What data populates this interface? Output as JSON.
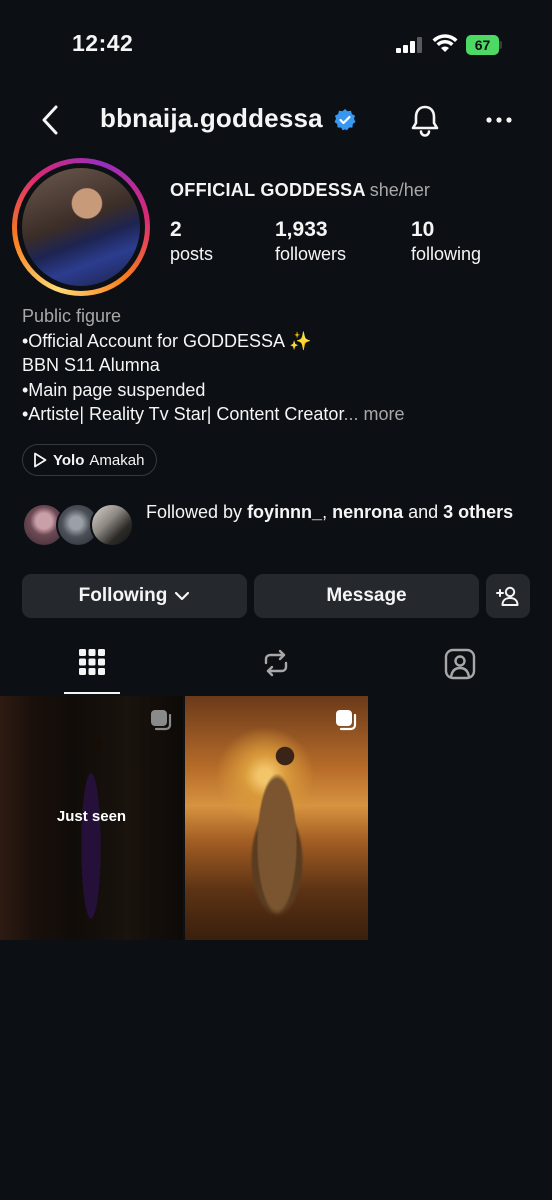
{
  "status_bar": {
    "time": "12:42",
    "battery": "67"
  },
  "header": {
    "username": "bbnaija.goddessa"
  },
  "profile": {
    "full_name": "OFFICIAL GODDESSA",
    "pronouns": "she/her",
    "stats": [
      {
        "value": "2",
        "label": "posts"
      },
      {
        "value": "1,933",
        "label": "followers"
      },
      {
        "value": "10",
        "label": "following"
      }
    ],
    "bio": {
      "category": "Public figure",
      "lines": [
        "•Official Account for GODDESSA ✨",
        "BBN S11 Alumna",
        "•Main page suspended",
        "•Artiste| Reality Tv Star| Content Creator"
      ],
      "ellipsis": "...",
      "more": "more"
    },
    "music": {
      "song": "Yolo",
      "artist": "Amakah"
    },
    "mutuals": {
      "prefix": "Followed by ",
      "user1": "foyinnn_",
      "sep": ", ",
      "user2": "nenrona",
      "and": " and ",
      "others": "3 others"
    }
  },
  "actions": {
    "following": "Following",
    "message": "Message"
  },
  "tabs": [
    "posts-grid",
    "reposts",
    "tagged"
  ],
  "posts": [
    {
      "overlay": "Just seen"
    },
    {
      "overlay": ""
    }
  ],
  "colors": {
    "background": "#0c1014",
    "button": "#25292e",
    "verified": "#3897f0",
    "battery": "#4cd964"
  },
  "icons": [
    "back-arrow-icon",
    "verified-badge-icon",
    "bell-icon",
    "more-icon",
    "play-icon",
    "chevron-down-icon",
    "add-person-icon",
    "grid-icon",
    "repost-icon",
    "tagged-icon",
    "multi-post-icon"
  ]
}
